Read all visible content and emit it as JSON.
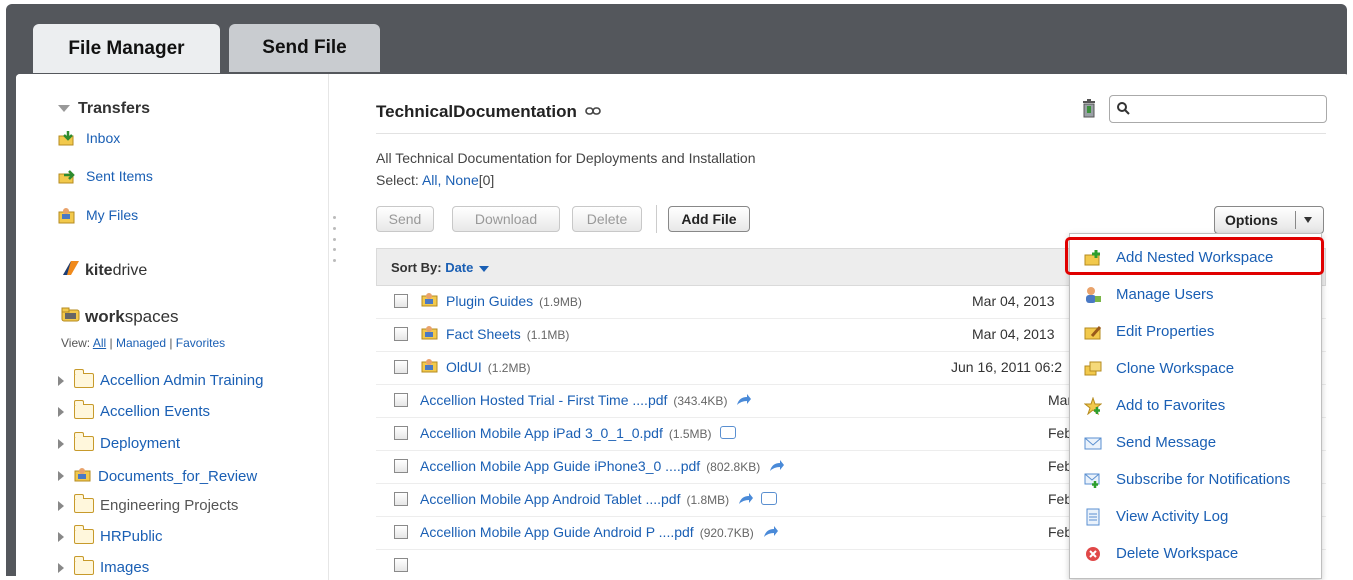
{
  "tabs": [
    {
      "label": "File Manager"
    },
    {
      "label": "Send File"
    }
  ],
  "sidebar": {
    "transfers_header": "Transfers",
    "items": [
      {
        "label": "Inbox",
        "icon": "inbox-icon"
      },
      {
        "label": "Sent Items",
        "icon": "sent-items-icon"
      },
      {
        "label": "My Files",
        "icon": "my-files-icon"
      }
    ],
    "kitedrive": {
      "bold": "kite",
      "rest": "drive"
    },
    "workspaces": {
      "bold": "work",
      "rest": "spaces"
    },
    "view": {
      "prefix": "View:",
      "all": "All",
      "managed": "Managed",
      "favorites": "Favorites"
    },
    "tree": [
      {
        "label": "Accellion Admin Training"
      },
      {
        "label": "Accellion Events"
      },
      {
        "label": "Deployment"
      },
      {
        "label": "Documents_for_Review"
      },
      {
        "label": "Engineering Projects"
      },
      {
        "label": "HRPublic"
      },
      {
        "label": "Images"
      }
    ]
  },
  "main": {
    "title": "TechnicalDocumentation",
    "description": "All Technical Documentation for Deployments and Installation",
    "select": {
      "prefix": "Select:",
      "all": "All,",
      "none": "None",
      "count": "[0]"
    },
    "buttons": {
      "send": "Send",
      "download": "Download",
      "delete": "Delete",
      "add_file": "Add File",
      "options": "Options"
    },
    "sort": {
      "prefix": "Sort By:",
      "value": "Date"
    },
    "rows": [
      {
        "name": "Plugin Guides",
        "size": "(1.9MB)",
        "date": "Mar 04, 2013"
      },
      {
        "name": "Fact Sheets",
        "size": "(1.1MB)",
        "date": "Mar 04, 2013"
      },
      {
        "name": "OldUI",
        "size": "(1.2MB)",
        "date": "Jun 16, 2011 06:2"
      },
      {
        "name": "Accellion Hosted Trial - First Time ....pdf",
        "size": "(343.4KB)",
        "date": "Mar"
      },
      {
        "name": "Accellion Mobile App iPad 3_0_1_0.pdf",
        "size": "(1.5MB)",
        "date": "Feb"
      },
      {
        "name": "Accellion Mobile App Guide iPhone3_0 ....pdf",
        "size": "(802.8KB)",
        "date": "Feb"
      },
      {
        "name": "Accellion Mobile App Android Tablet ....pdf",
        "size": "(1.8MB)",
        "date": "Feb"
      },
      {
        "name": "Accellion Mobile App Guide Android P ....pdf",
        "size": "(920.7KB)",
        "date": "Feb"
      }
    ]
  },
  "menu": {
    "items": [
      {
        "label": "Add Nested Workspace",
        "icon": "add-workspace-icon"
      },
      {
        "label": "Manage Users",
        "icon": "manage-users-icon"
      },
      {
        "label": "Edit Properties",
        "icon": "edit-properties-icon"
      },
      {
        "label": "Clone Workspace",
        "icon": "clone-workspace-icon"
      },
      {
        "label": "Add to Favorites",
        "icon": "add-favorite-icon"
      },
      {
        "label": "Send Message",
        "icon": "envelope-icon"
      },
      {
        "label": "Subscribe for Notifications",
        "icon": "subscribe-icon"
      },
      {
        "label": "View Activity Log",
        "icon": "activity-log-icon"
      },
      {
        "label": "Delete Workspace",
        "icon": "delete-workspace-icon"
      }
    ]
  },
  "colors": {
    "accent": "#1a5fb4",
    "highlight": "#e00000",
    "header_bg": "#54575c"
  }
}
